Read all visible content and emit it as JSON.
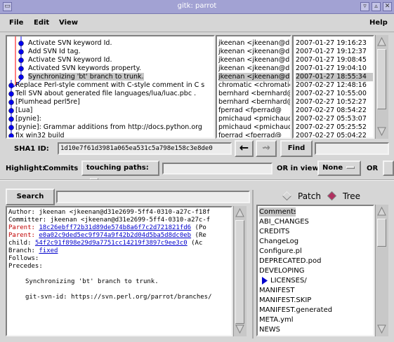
{
  "window": {
    "title": "gitk: parrot"
  },
  "menu": {
    "file": "File",
    "edit": "Edit",
    "view": "View",
    "help": "Help"
  },
  "commits": [
    {
      "subject": "Activate SVN keyword Id.",
      "author": "jkeenan <jkeenan@d3",
      "date": "2007-01-27 19:16:23"
    },
    {
      "subject": "Add SVN Id tag.",
      "author": "jkeenan <jkeenan@d3",
      "date": "2007-01-27 19:12:37"
    },
    {
      "subject": "Activate SVN keyword Id.",
      "author": "jkeenan <jkeenan@d3",
      "date": "2007-01-27 19:08:45"
    },
    {
      "subject": "Activated SVN keywords property.",
      "author": "jkeenan <jkeenan@d3",
      "date": "2007-01-27 19:04:10"
    },
    {
      "subject": "Synchronizing 'bt' branch to trunk.",
      "author": "jkeenan <jkeenan@d3",
      "date": "2007-01-27 18:55:34"
    },
    {
      "subject": "Replace Perl-style comment with C-style comment in C s",
      "author": "chromatic <chromatic",
      "date": "2007-02-27 12:48:16"
    },
    {
      "subject": "Tell SVN about generated file languages/lua/luac.pbc .",
      "author": "bernhard <bernhard@",
      "date": "2007-02-27 10:55:00"
    },
    {
      "subject": "[Plumhead perl5re]",
      "author": "bernhard <bernhard@",
      "date": "2007-02-27 10:52:27"
    },
    {
      "subject": "[Lua]",
      "author": "fperrad <fperrad@",
      "date": "2007-02-27 08:54:22"
    },
    {
      "subject": "[pynie]:",
      "author": "pmichaud <pmichaud@",
      "date": "2007-02-27 05:53:07"
    },
    {
      "subject": "[pynie]:  Grammar additions from http://docs.python.org",
      "author": "pmichaud <pmichaud@",
      "date": "2007-02-27 05:25:52"
    },
    {
      "subject": "fix win32 build",
      "author": "fperrad <fperrad@",
      "date": "2007-02-27 05:04:22"
    }
  ],
  "selected_commit_index": 4,
  "sha1": {
    "label": "SHA1 ID:",
    "value": "1d10e7f61d3981a065ea531c5a798e158c3e8de0"
  },
  "nav": {
    "back": "←",
    "forward": "⇝",
    "find": "Find"
  },
  "highlight": {
    "label": "Highlight:",
    "commits": "Commits",
    "touching": "touching paths:",
    "or_in_view": "OR in view",
    "none": "None",
    "or": "OR"
  },
  "search": {
    "button": "Search"
  },
  "filemode": {
    "patch": "Patch",
    "tree": "Tree",
    "selected": "Tree"
  },
  "diff": {
    "author_line": "Author: jkeenan <jkeenan@d31e2699-5ff4-0310-a27c-f18f",
    "committer_line": "Committer: jkeenan <jkeenan@d31e2699-5ff4-0310-a27c-f",
    "parent1_label": "Parent:",
    "parent1_hash": "18c26ebff72b31d89de574b8a6f7c2d721821fd6",
    "parent1_tail": " (Po",
    "parent2_label": "Parent:",
    "parent2_hash": "e0a02c9ded5ec9f974a9f42b2d04d5ba5d8dc0eb",
    "parent2_tail": " (Re",
    "child_label": "child:",
    "child_hash": "54f2c91f898e29d9a7751cc14219f3897c9ee3c0",
    "child_tail": " (Ac",
    "branch_label": "Branch:",
    "branch_value": "fixed",
    "follows": "Follows:",
    "precedes": "Precedes:",
    "message": "Synchronizing 'bt' branch to trunk.",
    "svn_id": "git-svn-id: https://svn.perl.org/parrot/branches/"
  },
  "files": [
    "Comments",
    "ABI_CHANGES",
    "CREDITS",
    "ChangeLog",
    "Configure.pl",
    "DEPRECATED.pod",
    "DEVELOPING",
    "LICENSES/",
    "MANIFEST",
    "MANIFEST.SKIP",
    "MANIFEST.generated",
    "META.yml",
    "NEWS"
  ],
  "colors": {
    "graph_line": "#0000ff",
    "graph_node": "#0000ee",
    "red_line": "#ff0000",
    "link": "#0000cc",
    "titlebar": "#a2a2d3"
  }
}
